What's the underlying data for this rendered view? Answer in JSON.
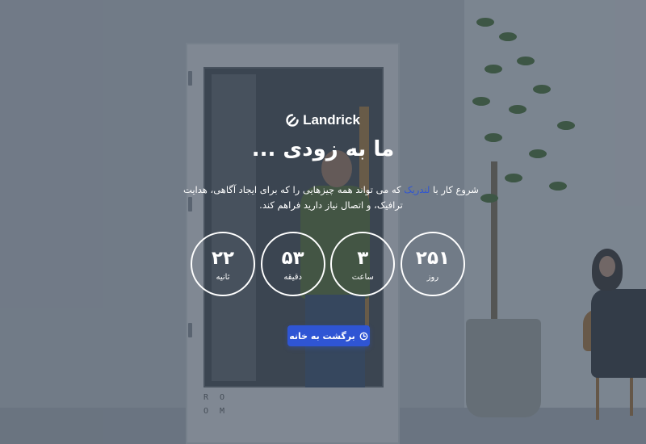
{
  "brand": {
    "name": "Landrick",
    "icon": "landrick-logo-icon"
  },
  "heading": "ما به زودی ...",
  "description": {
    "before_link": "شروع کار با ",
    "link_text": "لندریک",
    "after_link": " که می تواند همه چیزهایی را که برای ایجاد آگاهی، هدایت ترافیک، و اتصال نیاز دارید فراهم کند."
  },
  "countdown": [
    {
      "value": "۲۵۱",
      "label": "روز"
    },
    {
      "value": "۳",
      "label": "ساعت"
    },
    {
      "value": "۵۳",
      "label": "دقیقه"
    },
    {
      "value": "۲۲",
      "label": "ثانیه"
    }
  ],
  "back_button": {
    "label": "برگشت به خانه",
    "icon": "clock-icon"
  },
  "background": {
    "booth_lettering": [
      "R",
      "O",
      "O",
      "M"
    ]
  },
  "colors": {
    "accent": "#2f55d4",
    "overlay": "#3c4858",
    "text": "#ffffff"
  }
}
